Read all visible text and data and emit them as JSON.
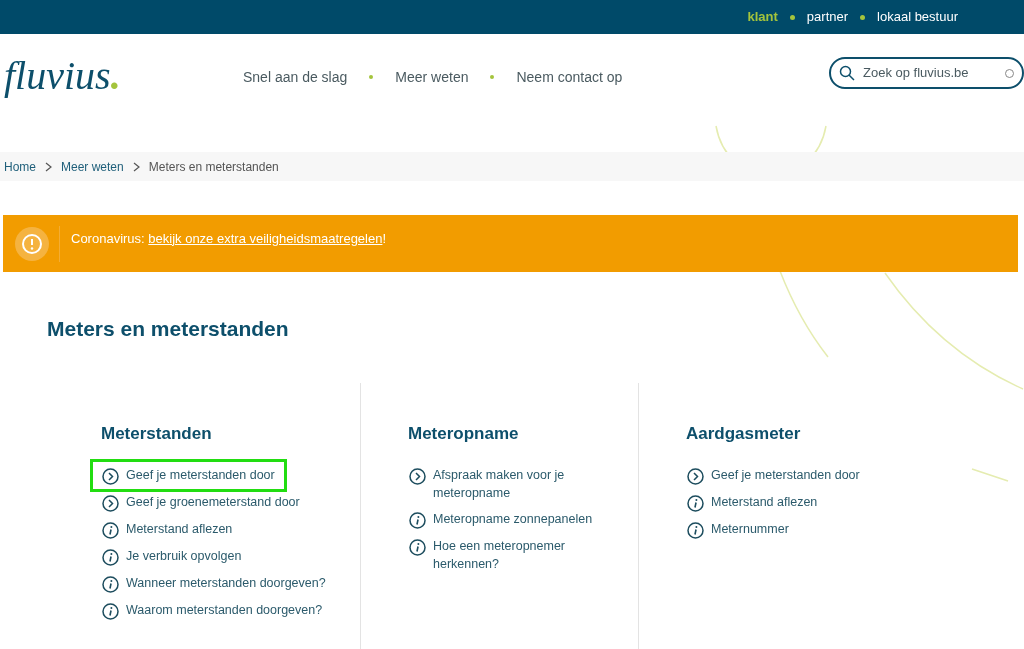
{
  "audience_nav": [
    {
      "label": "klant",
      "selected": true
    },
    {
      "label": "partner",
      "selected": false
    },
    {
      "label": "lokaal bestuur",
      "selected": false
    }
  ],
  "logo": {
    "name": "fluvius",
    "mark": "."
  },
  "main_nav": [
    "Snel aan de slag",
    "Meer weten",
    "Neem contact op"
  ],
  "search": {
    "placeholder": "Zoek op fluvius.be"
  },
  "breadcrumb": [
    "Home",
    "Meer weten",
    "Meters en meterstanden"
  ],
  "alert": {
    "label": "Coronavirus: ",
    "link": "bekijk onze extra veiligheidsmaatregelen",
    "suffix": "!"
  },
  "page_title": "Meters en meterstanden",
  "columns": [
    {
      "heading": "Meterstanden",
      "links": [
        {
          "kind": "arrow",
          "label": "Geef je meterstanden door",
          "highlighted": true
        },
        {
          "kind": "arrow",
          "label": "Geef je groenemeterstand door",
          "highlighted": false
        },
        {
          "kind": "info",
          "label": "Meterstand aflezen",
          "highlighted": false
        },
        {
          "kind": "info",
          "label": "Je verbruik opvolgen",
          "highlighted": false
        },
        {
          "kind": "info",
          "label": "Wanneer meterstanden doorgeven?",
          "highlighted": false
        },
        {
          "kind": "info",
          "label": "Waarom meterstanden doorgeven?",
          "highlighted": false
        }
      ]
    },
    {
      "heading": "Meteropname",
      "links": [
        {
          "kind": "arrow",
          "label": "Afspraak maken voor je meteropname",
          "highlighted": false
        },
        {
          "kind": "info",
          "label": "Meteropname zonnepanelen",
          "highlighted": false
        },
        {
          "kind": "info",
          "label": "Hoe een meteropnemer herkennen?",
          "highlighted": false
        }
      ]
    },
    {
      "heading": "Aardgasmeter",
      "links": [
        {
          "kind": "arrow",
          "label": "Geef je meterstanden door",
          "highlighted": false
        },
        {
          "kind": "info",
          "label": "Meterstand aflezen",
          "highlighted": false
        },
        {
          "kind": "info",
          "label": "Meternummer",
          "highlighted": false
        }
      ]
    }
  ]
}
